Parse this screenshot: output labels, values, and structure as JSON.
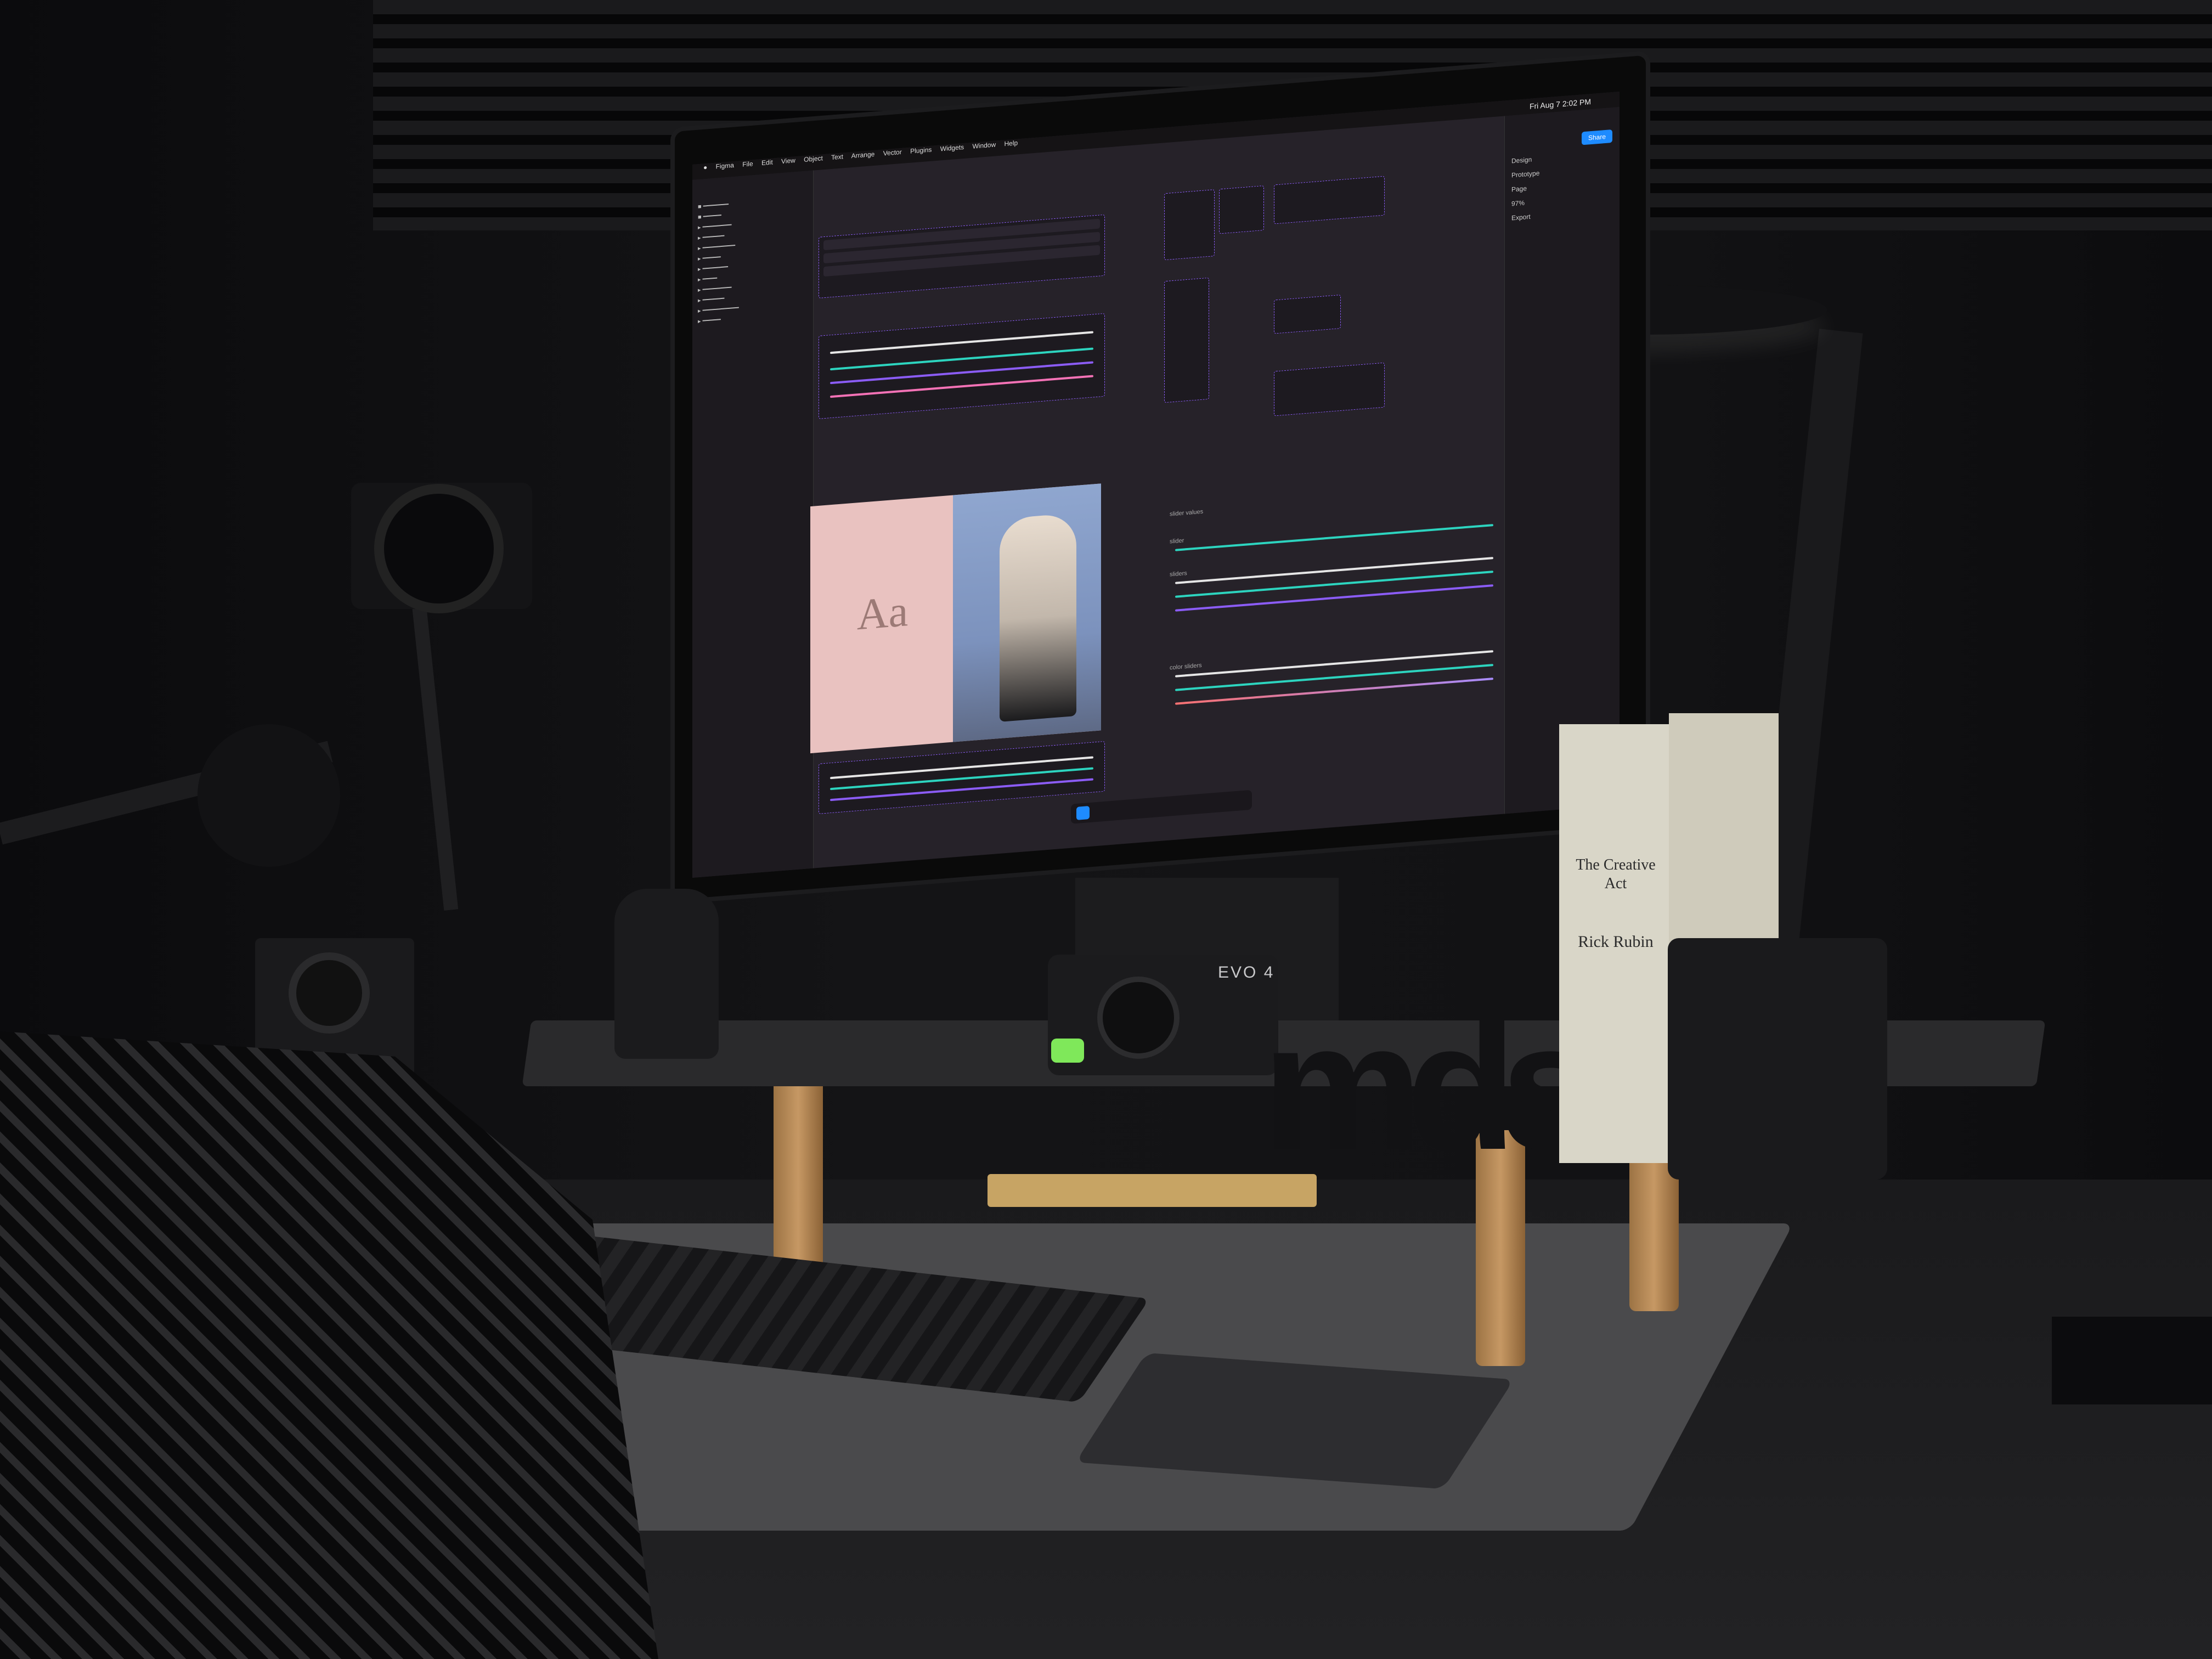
{
  "scene": {
    "description_visible_text_only": true
  },
  "screen": {
    "menubar": {
      "apps": [
        "Figma",
        "File",
        "Edit",
        "View",
        "Object",
        "Text",
        "Arrange",
        "Vector",
        "Plugins",
        "Widgets",
        "Window",
        "Help"
      ],
      "clock": "Fri Aug 7 2:02 PM"
    },
    "right_panel": {
      "tabs": [
        "Design",
        "Prototype"
      ],
      "share_label": "Share",
      "items": [
        "Page",
        "Export"
      ],
      "zoom": "97%"
    },
    "canvas_labels": {
      "slider_values": "slider values",
      "slider": "slider",
      "sliders": "sliders",
      "color_sliders": "color sliders",
      "sample_text": "Aa"
    }
  },
  "objects": {
    "book_title": "The Creative Act",
    "book_author": "Rick Rubin",
    "audio_interface_label": "EVO 4",
    "desk_sign": "mds"
  },
  "colors": {
    "accent_blue": "#1e8bff",
    "frame_purple": "#8b5cf6",
    "indicator_green": "#7fe85a"
  }
}
